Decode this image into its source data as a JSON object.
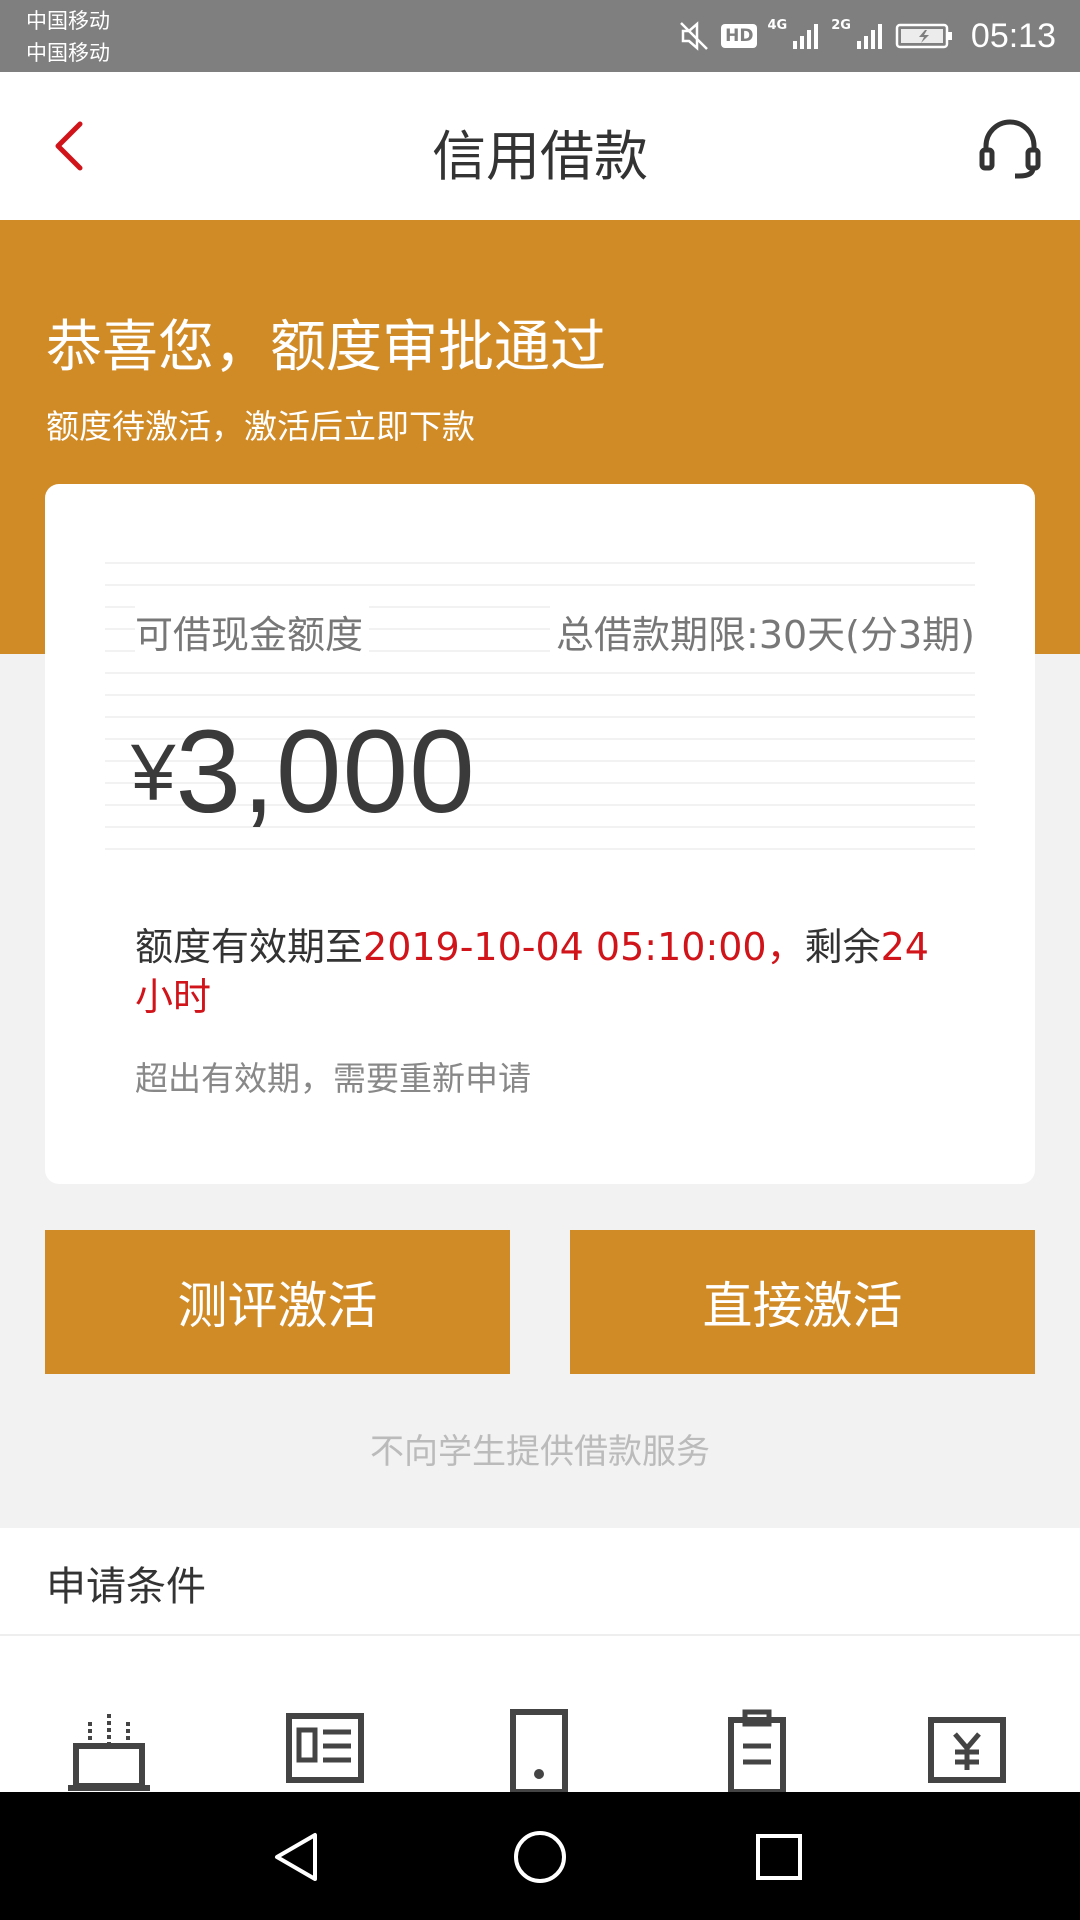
{
  "status_bar": {
    "carrier_1": "中国移动",
    "carrier_2": "中国移动",
    "hd": "HD",
    "net_1": "4G",
    "net_2": "2G",
    "time": "05:13"
  },
  "nav": {
    "title": "信用借款",
    "back_icon": "chevron-left-icon",
    "service_icon": "headset-icon"
  },
  "banner": {
    "title": "恭喜您，额度审批通过",
    "subtitle": "额度待激活，激活后立即下款"
  },
  "card": {
    "amount_label": "可借现金额度",
    "term_label": "总借款期限:30天(分3期)",
    "currency": "¥",
    "amount": "3,000",
    "validity_prefix": "额度有效期至",
    "validity_date": "2019-10-04 05:10:00，",
    "validity_mid": "剩余",
    "validity_remaining": "24小时",
    "note": "超出有效期，需要重新申请"
  },
  "buttons": {
    "assess_activate": "测评激活",
    "direct_activate": "直接激活"
  },
  "disclaimer": "不向学生提供借款服务",
  "conditions": {
    "title": "申请条件",
    "icons": [
      "cake-icon",
      "id-card-icon",
      "phone-icon",
      "clipboard-icon",
      "yen-card-icon"
    ]
  },
  "system_nav": {
    "back": "triangle-back-icon",
    "home": "circle-home-icon",
    "recent": "square-recent-icon"
  },
  "colors": {
    "accent": "#d18b26",
    "highlight_red": "#d0141a",
    "status_bar": "#7f7f7f"
  }
}
